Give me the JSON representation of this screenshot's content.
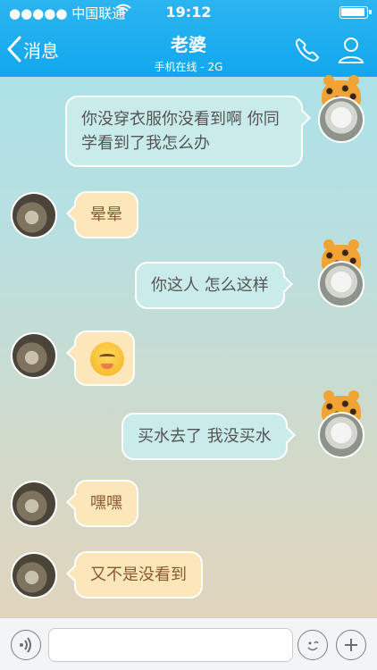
{
  "status_bar": {
    "carrier": "●●●●● 中国联通",
    "time": "19:12"
  },
  "header": {
    "back_label": "消息",
    "title": "老婆",
    "subtitle": "手机在线 - 2G"
  },
  "messages": [
    {
      "side": "out",
      "text": "你没穿衣服你没看到啊 你同学看到了我怎么办"
    },
    {
      "side": "in",
      "text": "晕晕"
    },
    {
      "side": "out",
      "text": "你这人  怎么这样"
    },
    {
      "side": "in",
      "emoji": "blushing-face-emoji"
    },
    {
      "side": "out",
      "text": "买水去了 我没买水"
    },
    {
      "side": "in",
      "text": "嘿嘿"
    },
    {
      "side": "in",
      "text": "又不是没看到"
    }
  ],
  "input": {
    "placeholder": ""
  },
  "icons": {
    "back": "chevron-left-icon",
    "call": "phone-icon",
    "profile": "profile-icon",
    "voice": "voice-icon",
    "emoji": "emoji-icon",
    "plus": "plus-icon"
  },
  "colors": {
    "top_bar": "#12a7ee",
    "outgoing_bubble": "#c9ecea",
    "incoming_bubble": "#fde6b9"
  }
}
